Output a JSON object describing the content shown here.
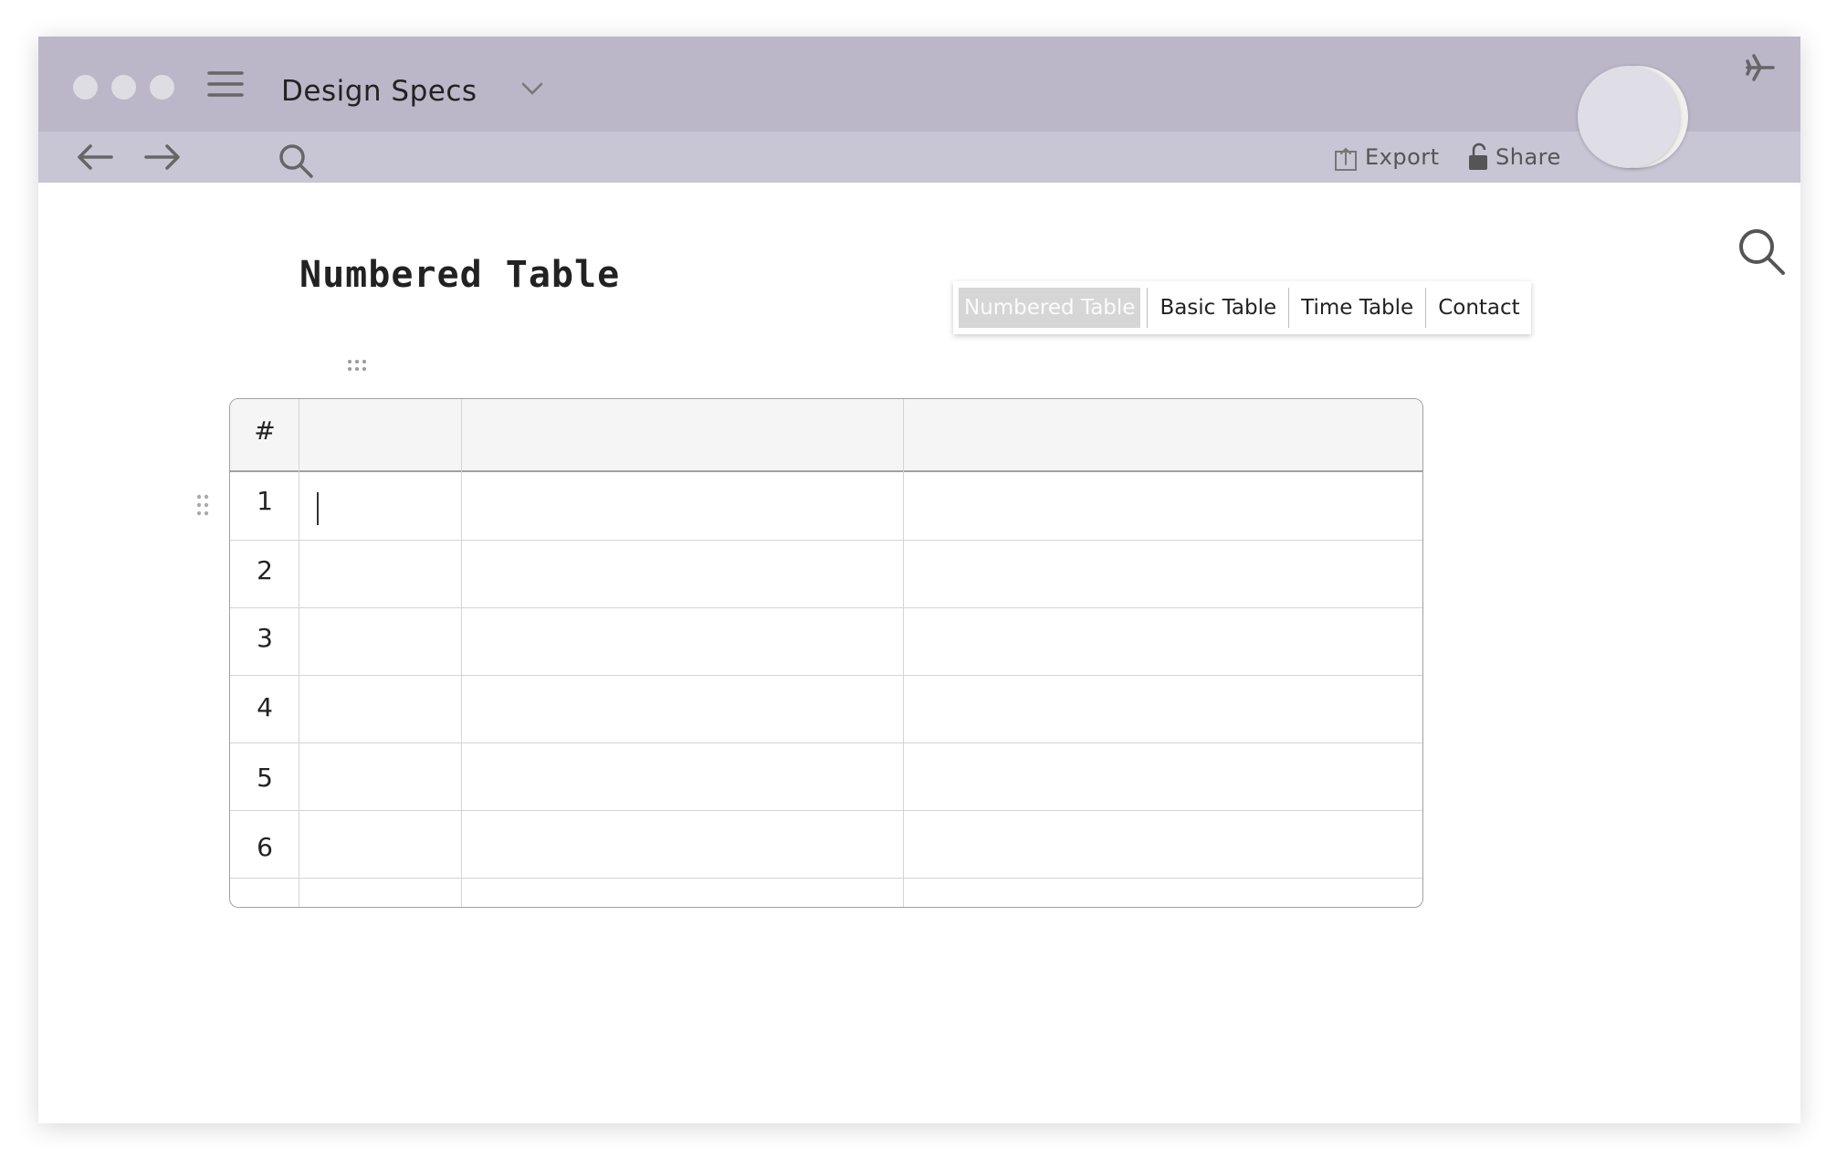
{
  "window": {
    "title": "Design Specs",
    "traffic_lights": [
      "close",
      "minimize",
      "zoom"
    ]
  },
  "toolbar": {
    "back_icon": "arrow-left-icon",
    "forward_icon": "arrow-right-icon",
    "search_icon": "search-icon",
    "export_label": "Export",
    "share_label": "Share"
  },
  "colors": {
    "titlebar": "#bbb7c9",
    "toolbar": "#c8c5d5",
    "active_tab": "#d6d6d6"
  },
  "page": {
    "title": "Numbered Table"
  },
  "tabs": [
    {
      "label": "Numbered Table",
      "active": true
    },
    {
      "label": "Basic Table",
      "active": false
    },
    {
      "label": "Time Table",
      "active": false
    },
    {
      "label": "Contact",
      "active": false
    }
  ],
  "table": {
    "header": [
      "#",
      "",
      "",
      ""
    ],
    "row_numbers": [
      "1",
      "2",
      "3",
      "4",
      "5",
      "6"
    ]
  }
}
